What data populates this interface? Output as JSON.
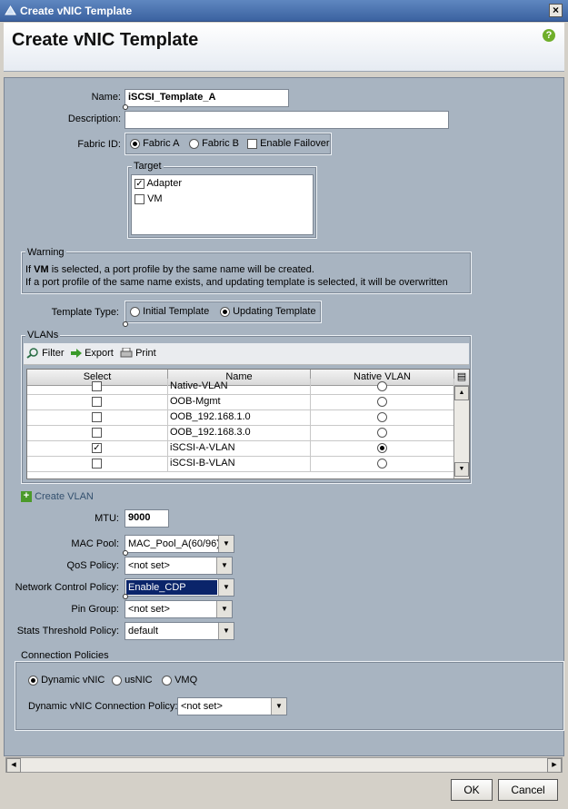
{
  "window": {
    "title": "Create vNIC Template",
    "close_glyph": "×"
  },
  "header": {
    "title": "Create vNIC Template",
    "help_glyph": "?"
  },
  "form": {
    "name_label": "Name:",
    "name_value": "iSCSI_Template_A",
    "description_label": "Description:",
    "description_value": "",
    "fabric_label": "Fabric ID:",
    "fabric_options": [
      "Fabric A",
      "Fabric B"
    ],
    "fabric_selected": "Fabric A",
    "enable_failover_label": "Enable Failover",
    "enable_failover_checked": false
  },
  "target": {
    "title": "Target",
    "items": [
      {
        "label": "Adapter",
        "checked": true
      },
      {
        "label": "VM",
        "checked": false
      }
    ]
  },
  "warning": {
    "title": "Warning",
    "line1_prefix": "If ",
    "line1_bold": "VM",
    "line1_suffix": " is selected, a port profile by the same name will be created.",
    "line2": "If a port profile of the same name exists, and updating template is selected, it will be overwritten"
  },
  "template_type": {
    "label": "Template Type:",
    "options": [
      "Initial Template",
      "Updating Template"
    ],
    "selected": "Updating Template"
  },
  "vlans": {
    "title": "VLANs",
    "toolbar": {
      "filter": "Filter",
      "export": "Export",
      "print": "Print"
    },
    "columns": [
      "Select",
      "Name",
      "Native VLAN"
    ],
    "rows": [
      {
        "name": "Native-VLAN",
        "selected": false,
        "native": false
      },
      {
        "name": "OOB-Mgmt",
        "selected": false,
        "native": false
      },
      {
        "name": "OOB_192.168.1.0",
        "selected": false,
        "native": false
      },
      {
        "name": "OOB_192.168.3.0",
        "selected": false,
        "native": false
      },
      {
        "name": "iSCSI-A-VLAN",
        "selected": true,
        "native": true
      },
      {
        "name": "iSCSI-B-VLAN",
        "selected": false,
        "native": false
      }
    ],
    "create_label": "Create VLAN"
  },
  "settings": {
    "mtu_label": "MTU:",
    "mtu_value": "9000",
    "mac_pool_label": "MAC Pool:",
    "mac_pool_value": "MAC_Pool_A(60/96)",
    "qos_label": "QoS Policy:",
    "qos_value": "<not set>",
    "ncp_label": "Network Control Policy:",
    "ncp_value": "Enable_CDP",
    "pin_group_label": "Pin Group:",
    "pin_group_value": "<not set>",
    "stats_label": "Stats Threshold Policy:",
    "stats_value": "default"
  },
  "connection": {
    "title": "Connection Policies",
    "options": [
      "Dynamic vNIC",
      "usNIC",
      "VMQ"
    ],
    "selected": "Dynamic vNIC",
    "dyn_policy_label": "Dynamic vNIC Connection Policy:",
    "dyn_policy_value": "<not set>"
  },
  "footer": {
    "ok": "OK",
    "cancel": "Cancel"
  },
  "colors": {
    "panel": "#a8b4c1",
    "titlebar": "#3b62a0",
    "selection": "#0a246a"
  }
}
